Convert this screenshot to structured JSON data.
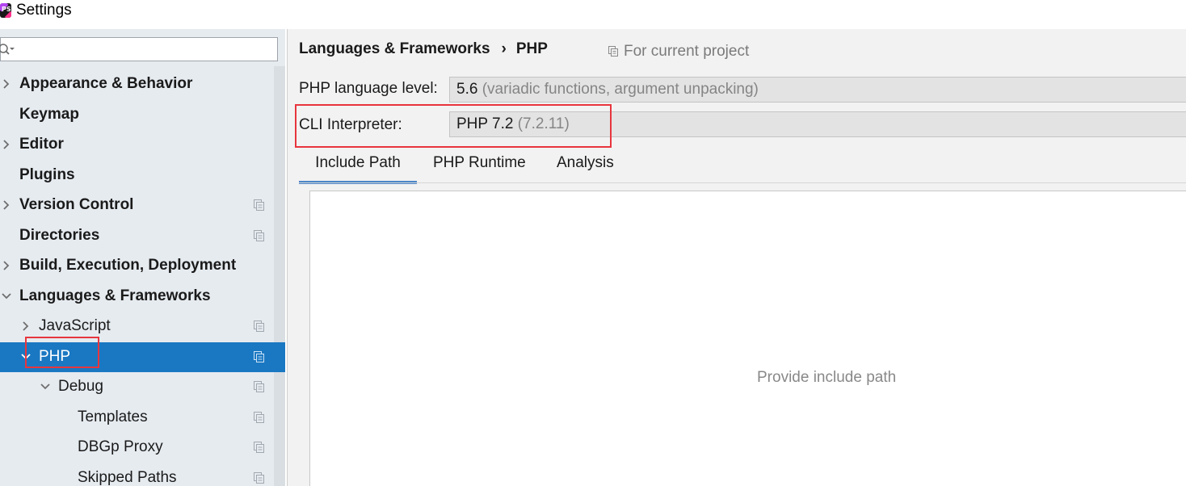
{
  "window": {
    "title": "Settings",
    "app_icon_text": "PS"
  },
  "sidebar": {
    "search": {
      "value": "",
      "placeholder": ""
    },
    "items": [
      {
        "label": "Appearance & Behavior",
        "bold": true,
        "arrow": "right",
        "copy_icon": false
      },
      {
        "label": "Keymap",
        "bold": true,
        "arrow": "none",
        "copy_icon": false
      },
      {
        "label": "Editor",
        "bold": true,
        "arrow": "right",
        "copy_icon": false
      },
      {
        "label": "Plugins",
        "bold": true,
        "arrow": "none",
        "copy_icon": false
      },
      {
        "label": "Version Control",
        "bold": true,
        "arrow": "right",
        "copy_icon": true
      },
      {
        "label": "Directories",
        "bold": true,
        "arrow": "none",
        "copy_icon": true
      },
      {
        "label": "Build, Execution, Deployment",
        "bold": true,
        "arrow": "right",
        "copy_icon": false
      },
      {
        "label": "Languages & Frameworks",
        "bold": true,
        "arrow": "down",
        "copy_icon": false
      },
      {
        "label": "JavaScript",
        "bold": false,
        "arrow": "right",
        "copy_icon": true
      },
      {
        "label": "PHP",
        "bold": false,
        "arrow": "down",
        "copy_icon": true,
        "selected": true
      },
      {
        "label": "Debug",
        "bold": false,
        "arrow": "down",
        "copy_icon": true
      },
      {
        "label": "Templates",
        "bold": false,
        "arrow": "none",
        "copy_icon": true
      },
      {
        "label": "DBGp Proxy",
        "bold": false,
        "arrow": "none",
        "copy_icon": true
      },
      {
        "label": "Skipped Paths",
        "bold": false,
        "arrow": "none",
        "copy_icon": true
      }
    ]
  },
  "main": {
    "breadcrumb": {
      "parent": "Languages & Frameworks",
      "separator": "›",
      "current": "PHP"
    },
    "scope_label": "For current project",
    "language_level": {
      "label": "PHP language level:",
      "value": "5.6",
      "detail": "(variadic functions, argument unpacking)"
    },
    "cli_interpreter": {
      "label": "CLI Interpreter:",
      "value": "PHP 7.2",
      "detail": "(7.2.11)"
    },
    "tabs": [
      {
        "label": "Include Path",
        "active": true
      },
      {
        "label": "PHP Runtime",
        "active": false
      },
      {
        "label": "Analysis",
        "active": false
      }
    ],
    "include_path_empty_text": "Provide include path"
  },
  "colors": {
    "selection": "#1a78c2",
    "highlight_box": "#e8353d",
    "active_tab_underline": "#4a86c8",
    "sidebar_bg": "#e6ebf0"
  }
}
